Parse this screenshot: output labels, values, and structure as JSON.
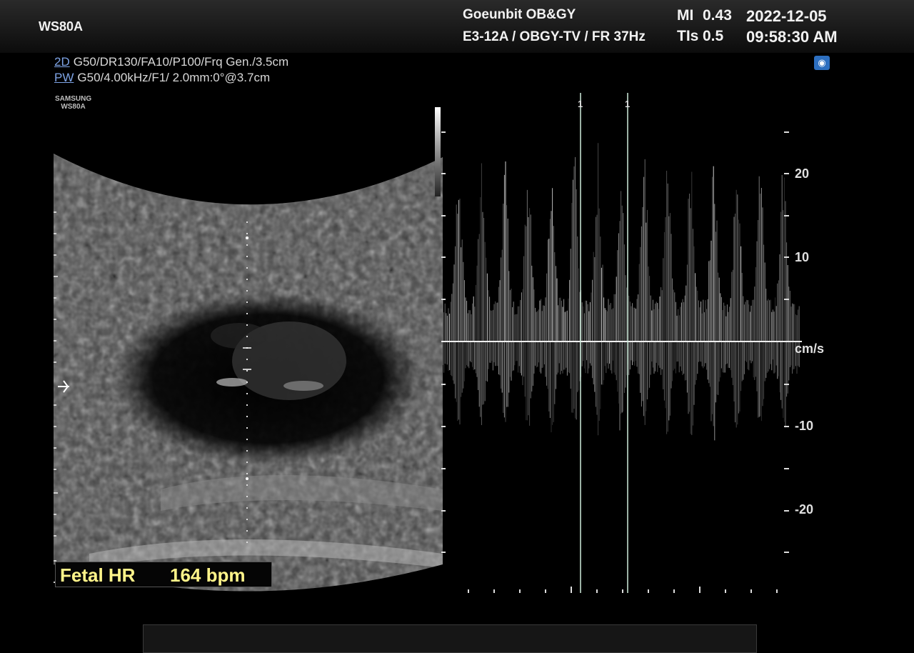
{
  "header": {
    "device": "WS80A",
    "institution": "Goeunbit OB&GY",
    "preset": "E3-12A / OBGY-TV / FR 37Hz",
    "mi_label": "MI",
    "mi_value": "0.43",
    "tis_label": "TIs",
    "tis_value": "0.5",
    "date": "2022-12-05",
    "time": "09:58:30 AM"
  },
  "params": {
    "mode_2d": "2D",
    "params_2d": "G50/DR130/FA10/P100/Frq Gen./3.5cm",
    "mode_pw": "PW",
    "params_pw": "G50/4.00kHz/F1/ 2.0mm:0°@3.7cm"
  },
  "brand": {
    "line1": "SAMSUNG",
    "line2": "WS80A"
  },
  "measurement": {
    "label": "Fetal HR",
    "value": "164 bpm"
  },
  "doppler": {
    "unit": "cm/s",
    "scale_labels": [
      "20",
      "10",
      "-10",
      "-20"
    ],
    "caliper_labels": [
      "1",
      "1"
    ]
  },
  "icons": {
    "probe": "probe-icon"
  }
}
